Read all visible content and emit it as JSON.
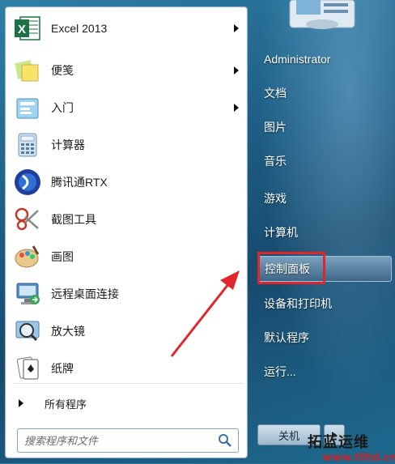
{
  "programs": [
    {
      "label": "Excel 2013",
      "icon": "excel-icon",
      "has_submenu": true
    },
    {
      "label": "便笺",
      "icon": "sticky-notes-icon",
      "has_submenu": true
    },
    {
      "label": "入门",
      "icon": "getting-started-icon",
      "has_submenu": true
    },
    {
      "label": "计算器",
      "icon": "calculator-icon",
      "has_submenu": false
    },
    {
      "label": "腾讯通RTX",
      "icon": "rtx-icon",
      "has_submenu": false
    },
    {
      "label": "截图工具",
      "icon": "snipping-tool-icon",
      "has_submenu": false
    },
    {
      "label": "画图",
      "icon": "paint-icon",
      "has_submenu": false
    },
    {
      "label": "远程桌面连接",
      "icon": "remote-desktop-icon",
      "has_submenu": false
    },
    {
      "label": "放大镜",
      "icon": "magnifier-icon",
      "has_submenu": false
    },
    {
      "label": "纸牌",
      "icon": "solitaire-icon",
      "has_submenu": false
    }
  ],
  "all_programs": {
    "label": "所有程序"
  },
  "search": {
    "placeholder": "搜索程序和文件"
  },
  "right_menu": [
    {
      "label": "Administrator"
    },
    {
      "label": "文档"
    },
    {
      "label": "图片"
    },
    {
      "label": "音乐"
    },
    {
      "label": "游戏"
    },
    {
      "label": "计算机"
    },
    {
      "label": "控制面板",
      "highlighted": true
    },
    {
      "label": "设备和打印机"
    },
    {
      "label": "默认程序"
    },
    {
      "label": "运行..."
    }
  ],
  "shutdown": {
    "label": "关机"
  },
  "watermark": {
    "line1": "拓蓝运维",
    "line2": "www.tlltd.cn"
  },
  "colors": {
    "highlight_box": "#e0262b",
    "arrow": "#e0262b"
  }
}
